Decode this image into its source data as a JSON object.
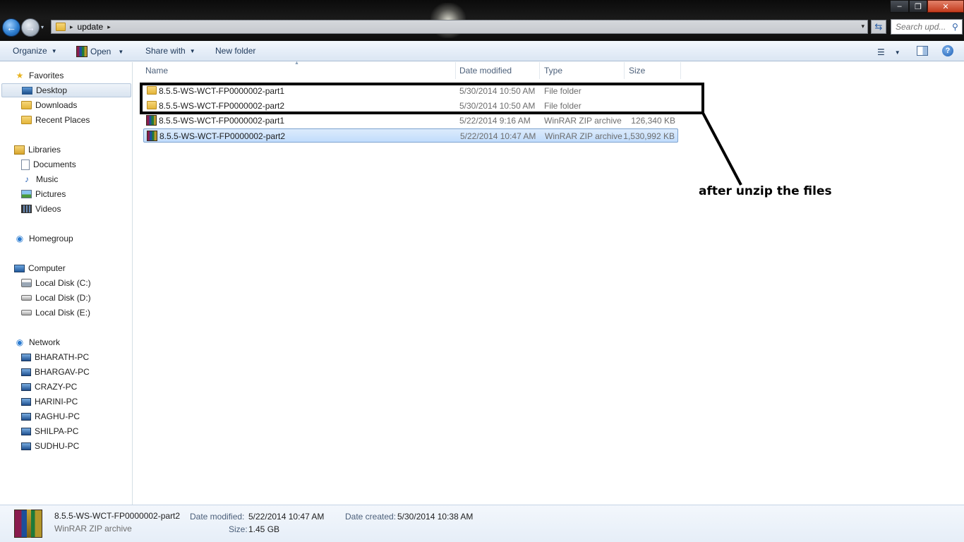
{
  "window": {
    "minimize": "–",
    "maximize": "❐",
    "close": "✕"
  },
  "address": {
    "crumbs": [
      "update"
    ],
    "sep": "▸",
    "dropdown": "▾",
    "refresh": "⇆"
  },
  "search": {
    "placeholder": "Search upd..."
  },
  "toolbar": {
    "organize": "Organize",
    "open": "Open",
    "share_with": "Share with",
    "new_folder": "New folder",
    "arrow": "▼",
    "help": "?"
  },
  "nav": {
    "favorites": "Favorites",
    "desktop": "Desktop",
    "downloads": "Downloads",
    "recent_places": "Recent Places",
    "libraries": "Libraries",
    "documents": "Documents",
    "music": "Music",
    "pictures": "Pictures",
    "videos": "Videos",
    "homegroup": "Homegroup",
    "computer": "Computer",
    "disk_c": "Local Disk (C:)",
    "disk_d": "Local Disk (D:)",
    "disk_e": "Local Disk (E:)",
    "network": "Network",
    "network_pcs": [
      "BHARATH-PC",
      "BHARGAV-PC",
      "CRAZY-PC",
      "HARINI-PC",
      "RAGHU-PC",
      "SHILPA-PC",
      "SUDHU-PC"
    ]
  },
  "columns": {
    "name": "Name",
    "date": "Date modified",
    "type": "Type",
    "size": "Size"
  },
  "files": [
    {
      "name": "8.5.5-WS-WCT-FP0000002-part1",
      "date": "5/30/2014 10:50 AM",
      "type": "File folder",
      "size": "",
      "kind": "folder"
    },
    {
      "name": "8.5.5-WS-WCT-FP0000002-part2",
      "date": "5/30/2014 10:50 AM",
      "type": "File folder",
      "size": "",
      "kind": "folder"
    },
    {
      "name": "8.5.5-WS-WCT-FP0000002-part1",
      "date": "5/22/2014 9:16 AM",
      "type": "WinRAR ZIP archive",
      "size": "126,340 KB",
      "kind": "archive"
    },
    {
      "name": "8.5.5-WS-WCT-FP0000002-part2",
      "date": "5/22/2014 10:47 AM",
      "type": "WinRAR ZIP archive",
      "size": "1,530,992 KB",
      "kind": "archive",
      "selected": true
    }
  ],
  "annotation": {
    "text": "after unzip the files"
  },
  "details": {
    "name": "8.5.5-WS-WCT-FP0000002-part2",
    "type": "WinRAR ZIP archive",
    "modified_label": "Date modified:",
    "modified_value": "5/22/2014 10:47 AM",
    "size_label": "Size:",
    "size_value": "1.45 GB",
    "created_label": "Date created:",
    "created_value": "5/30/2014 10:38 AM"
  }
}
